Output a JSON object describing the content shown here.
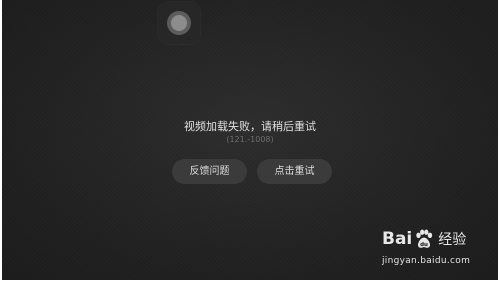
{
  "player": {
    "error_message": "视频加载失败，请稍后重试",
    "error_code": "(121.-1008)",
    "feedback_label": "反馈问题",
    "retry_label": "点击重试"
  },
  "watermark": {
    "logo_text_left": "Bai",
    "logo_text_right": "du",
    "logo_text_cn": "经验",
    "url": "jingyan.baidu.com"
  },
  "icons": {
    "floating_button": "floating-ball-icon",
    "watermark_paw": "baidu-paw-icon"
  },
  "colors": {
    "background": "#232323",
    "button_bg": "#3b3b3b",
    "text_primary": "#e0e0e0",
    "text_secondary": "#6d6d6d"
  }
}
